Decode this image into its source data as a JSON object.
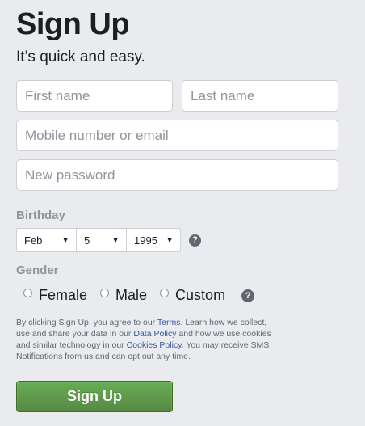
{
  "header": {
    "title": "Sign Up",
    "subtitle": "It’s quick and easy."
  },
  "form": {
    "first_name_placeholder": "First name",
    "last_name_placeholder": "Last name",
    "contact_placeholder": "Mobile number or email",
    "password_placeholder": "New password"
  },
  "birthday": {
    "label": "Birthday",
    "month": "Feb",
    "day": "5",
    "year": "1995",
    "help": "?"
  },
  "gender": {
    "label": "Gender",
    "options": [
      "Female",
      "Male",
      "Custom"
    ],
    "help": "?"
  },
  "legal": {
    "t1": "By clicking Sign Up, you agree to our ",
    "terms_link": "Terms",
    "t2": ". Learn how we collect, use and share your data in our ",
    "data_policy_link": "Data Policy",
    "t3": " and how we use cookies and similar technology in our ",
    "cookies_policy_link": "Cookies Policy",
    "t4": ". You may receive SMS Notifications from us and can opt out any time."
  },
  "submit": {
    "label": "Sign Up"
  },
  "colors": {
    "background": "#e9ebee",
    "link": "#365899",
    "button_green": "#69a74e"
  }
}
